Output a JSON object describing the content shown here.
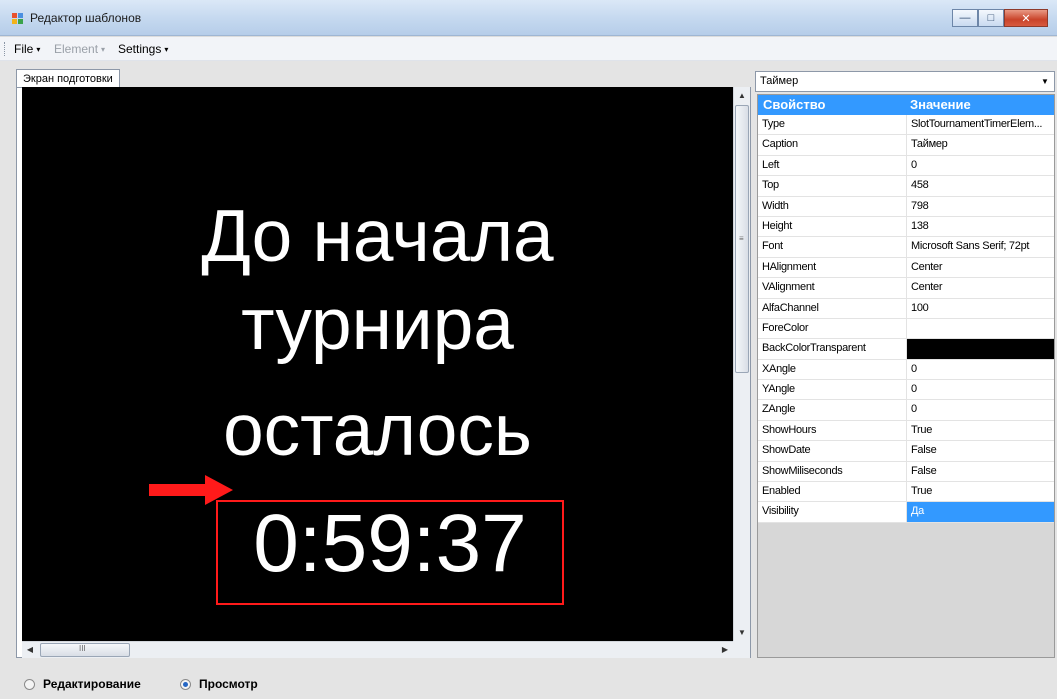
{
  "window": {
    "title": "Редактор шаблонов",
    "buttons": {
      "minimize": "—",
      "maximize": "□",
      "close": "✕"
    }
  },
  "menu": {
    "file": "File",
    "element": "Element",
    "settings": "Settings",
    "arrow": "▾"
  },
  "tab": {
    "label": "Экран подготовки"
  },
  "preview": {
    "line1": "До начала",
    "line2": "турнира",
    "line3": "осталось",
    "timer": "0:59:37",
    "scroll_up": "▲",
    "scroll_down": "▼",
    "scroll_left": "◀",
    "scroll_right": "▶",
    "grip_v": "≡",
    "grip_h": "III"
  },
  "element_select": {
    "value": "Таймер",
    "arrow": "▼"
  },
  "properties": {
    "header_property": "Свойство",
    "header_value": "Значение",
    "rows": [
      {
        "name": "Type",
        "value": "SlotTournamentTimerElem..."
      },
      {
        "name": "Caption",
        "value": "Таймер"
      },
      {
        "name": "Left",
        "value": "0"
      },
      {
        "name": "Top",
        "value": "458"
      },
      {
        "name": "Width",
        "value": "798"
      },
      {
        "name": "Height",
        "value": "138"
      },
      {
        "name": "Font",
        "value": "Microsoft Sans Serif; 72pt"
      },
      {
        "name": "HAlignment",
        "value": "Center"
      },
      {
        "name": "VAlignment",
        "value": "Center"
      },
      {
        "name": "AlfaChannel",
        "value": "100"
      },
      {
        "name": "ForeColor",
        "value": ""
      },
      {
        "name": "BackColorTransparent",
        "value": ""
      },
      {
        "name": "XAngle",
        "value": "0"
      },
      {
        "name": "YAngle",
        "value": "0"
      },
      {
        "name": "ZAngle",
        "value": "0"
      },
      {
        "name": "ShowHours",
        "value": "True"
      },
      {
        "name": "ShowDate",
        "value": "False"
      },
      {
        "name": "ShowMiliseconds",
        "value": "False"
      },
      {
        "name": "Enabled",
        "value": "True"
      },
      {
        "name": "Visibility",
        "value": "Да"
      }
    ]
  },
  "mode": {
    "edit": "Редактирование",
    "view": "Просмотр"
  },
  "colors": {
    "selection": "#3399ff",
    "highlight_box": "#ff1a1a",
    "canvas_bg": "#000000"
  }
}
